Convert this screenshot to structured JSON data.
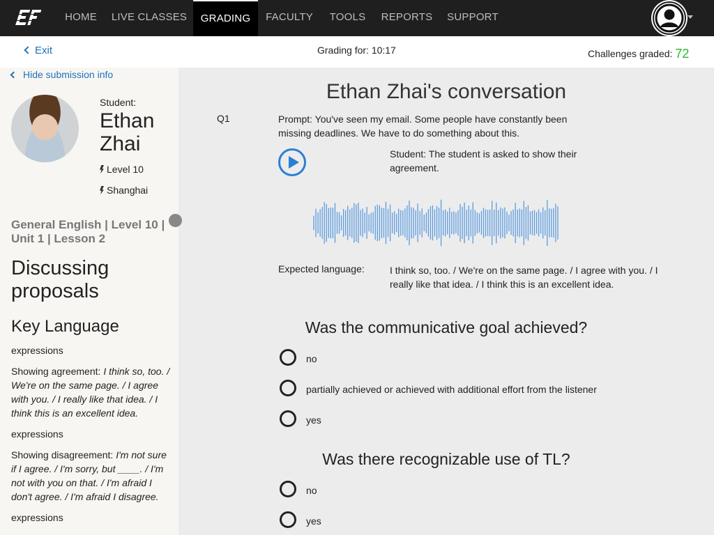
{
  "nav": {
    "logo_text": "EF",
    "items": [
      {
        "label": "HOME"
      },
      {
        "label": "LIVE CLASSES"
      },
      {
        "label": "GRADING"
      },
      {
        "label": "FACULTY"
      },
      {
        "label": "TOOLS"
      },
      {
        "label": "REPORTS"
      },
      {
        "label": "SUPPORT"
      }
    ],
    "active_index": 2
  },
  "subheader": {
    "exit_label": "Exit",
    "grading_for": "Grading for: 10:17",
    "challenges_label": "Challenges graded:",
    "challenges_count": "72"
  },
  "sidebar": {
    "hide_label": "Hide submission info",
    "student_label": "Student:",
    "student_name": "Ethan Zhai",
    "level": "Level 10",
    "city": "Shanghai",
    "course": "General English | Level 10 | Unit 1 | Lesson 2",
    "lesson_title": "Discussing proposals",
    "key_language_heading": "Key Language",
    "blocks": [
      {
        "type": "expressions"
      },
      {
        "lead": "Showing agreement: ",
        "phrases": "I think so, too. / We're on the same page. / I agree with you. / I really like that idea. / I think this is an excellent idea."
      },
      {
        "type": "expressions"
      },
      {
        "lead": "Showing disagreement: ",
        "phrases": "I'm not sure if I agree. / I'm sorry, but ____. / I'm not with you on that. / I'm afraid I don't agree. / I'm afraid I disagree."
      },
      {
        "type": "expressions"
      }
    ]
  },
  "main": {
    "title": "Ethan Zhai's conversation",
    "q_label": "Q1",
    "prompt": "Prompt: You've seen my email. Some people have constantly been missing deadlines. We have to do something about this.",
    "student_task": "Student: The student is asked to show their agreement.",
    "expected_label": "Expected language:",
    "expected_text": "I think so, too. / We're on the same page. / I agree with you. / I really like that idea. / I think this is an excellent idea.",
    "questions": [
      {
        "text": "Was the communicative goal achieved?",
        "options": [
          "no",
          "partially achieved or achieved with additional effort from the listener",
          "yes"
        ]
      },
      {
        "text": "Was there recognizable use of TL?",
        "options": [
          "no",
          "yes"
        ]
      }
    ]
  },
  "colors": {
    "nav_bg": "#1f1f1f",
    "link": "#1f72bb",
    "accent_green": "#2fb52f",
    "play_blue": "#2a7fd4",
    "waveform": "#5b9be0"
  },
  "icons": [
    "ef-logo-icon",
    "user-avatar-icon",
    "chevron-left-icon",
    "bolt-icon",
    "play-icon",
    "waveform-icon",
    "radio-icon"
  ]
}
